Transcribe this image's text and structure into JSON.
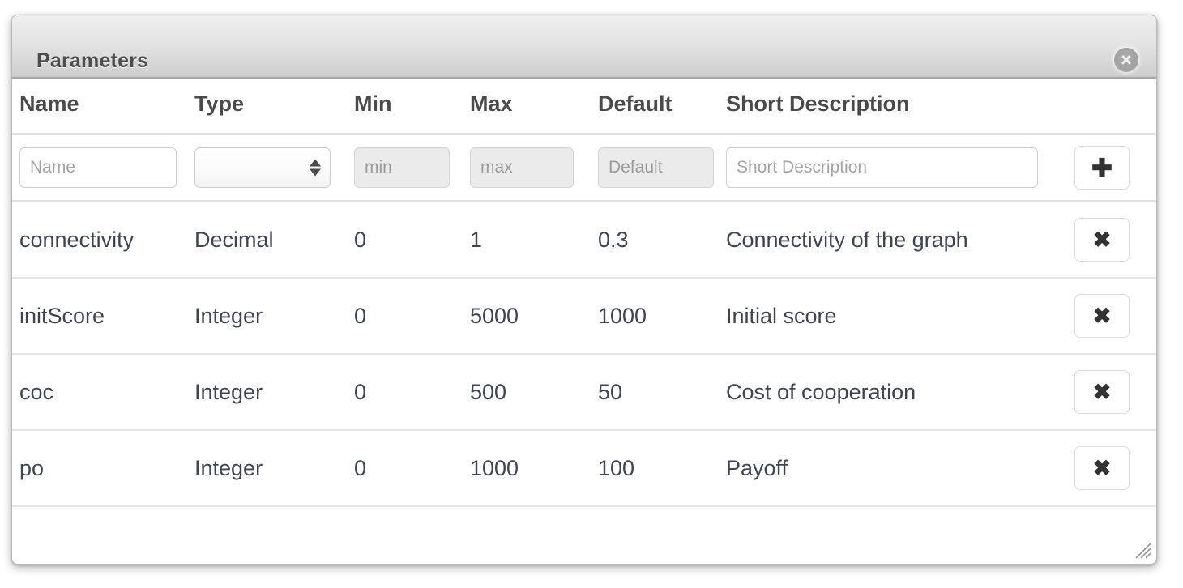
{
  "window": {
    "title": "Parameters",
    "close_icon": "close-circle-icon",
    "resize_icon": "resize-grip-icon"
  },
  "table": {
    "headers": [
      "Name",
      "Type",
      "Min",
      "Max",
      "Default",
      "Short Description"
    ],
    "input_row": {
      "name_placeholder": "Name",
      "type_value": "",
      "type_options": [
        ""
      ],
      "min_placeholder": "min",
      "max_placeholder": "max",
      "default_placeholder": "Default",
      "description_placeholder": "Short Description",
      "add_label": "✚",
      "add_icon": "plus-icon"
    },
    "rows": [
      {
        "name": "connectivity",
        "type": "Decimal",
        "min": "0",
        "max": "1",
        "default": "0.3",
        "description": "Connectivity of the graph",
        "delete_label": "✖",
        "delete_icon": "close-x-icon"
      },
      {
        "name": "initScore",
        "type": "Integer",
        "min": "0",
        "max": "5000",
        "default": "1000",
        "description": "Initial score",
        "delete_label": "✖",
        "delete_icon": "close-x-icon"
      },
      {
        "name": "coc",
        "type": "Integer",
        "min": "0",
        "max": "500",
        "default": "50",
        "description": "Cost of cooperation",
        "delete_label": "✖",
        "delete_icon": "close-x-icon"
      },
      {
        "name": "po",
        "type": "Integer",
        "min": "0",
        "max": "1000",
        "default": "100",
        "description": "Payoff",
        "delete_label": "✖",
        "delete_icon": "close-x-icon"
      }
    ]
  },
  "colors": {
    "titlebar_top": "#eeeeee",
    "titlebar_bottom": "#c6c6c6",
    "text": "#3f4550",
    "header_text": "#4a4a4a",
    "separator": "#e6e6e6"
  }
}
